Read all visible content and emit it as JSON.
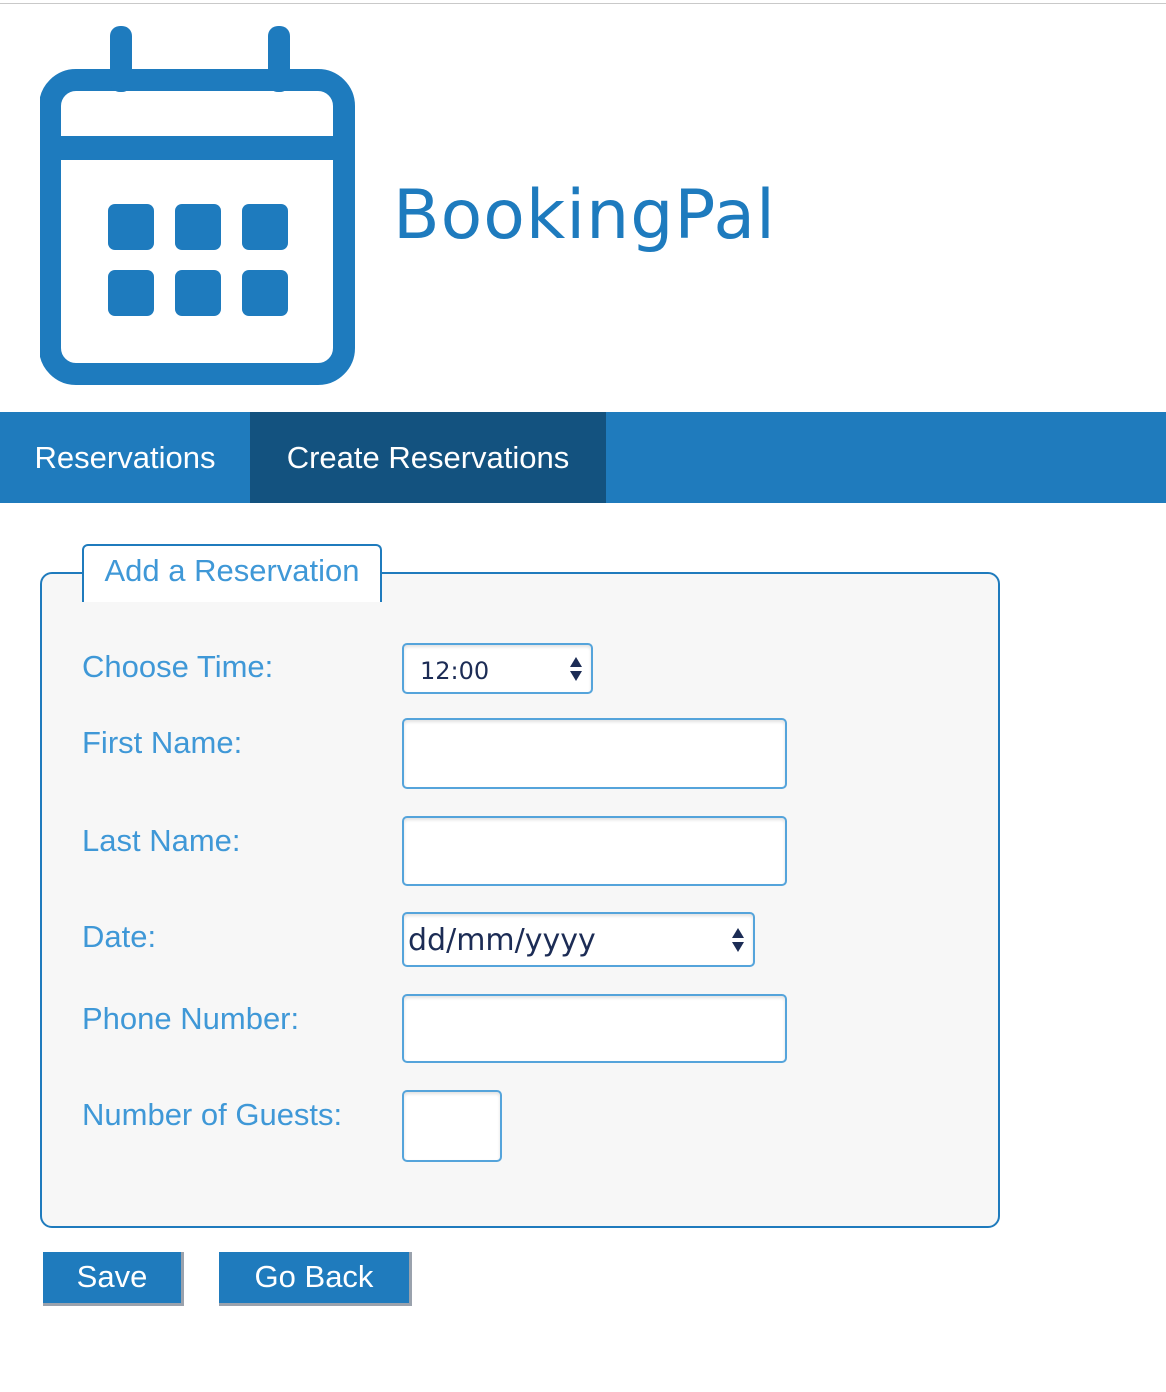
{
  "brand": {
    "name": "BookingPal",
    "color": "#1e7bbe",
    "logo_icon": "calendar-icon"
  },
  "nav": {
    "items": [
      {
        "label": "Reservations",
        "active": false
      },
      {
        "label": "Create Reservations",
        "active": true
      }
    ]
  },
  "form": {
    "legend": "Add a Reservation",
    "time": {
      "label": "Choose Time:",
      "value": "12:00"
    },
    "first_name": {
      "label": "First Name:",
      "value": ""
    },
    "last_name": {
      "label": "Last Name:",
      "value": ""
    },
    "date": {
      "label": "Date:",
      "value": "dd/mm/yyyy"
    },
    "phone": {
      "label": "Phone Number:",
      "value": ""
    },
    "guests": {
      "label": "Number of Guests:",
      "value": ""
    }
  },
  "buttons": {
    "save": "Save",
    "go_back": "Go Back"
  },
  "colors": {
    "primary": "#1f7bbd",
    "nav_active": "#13527f",
    "label_text": "#3f98d7"
  }
}
